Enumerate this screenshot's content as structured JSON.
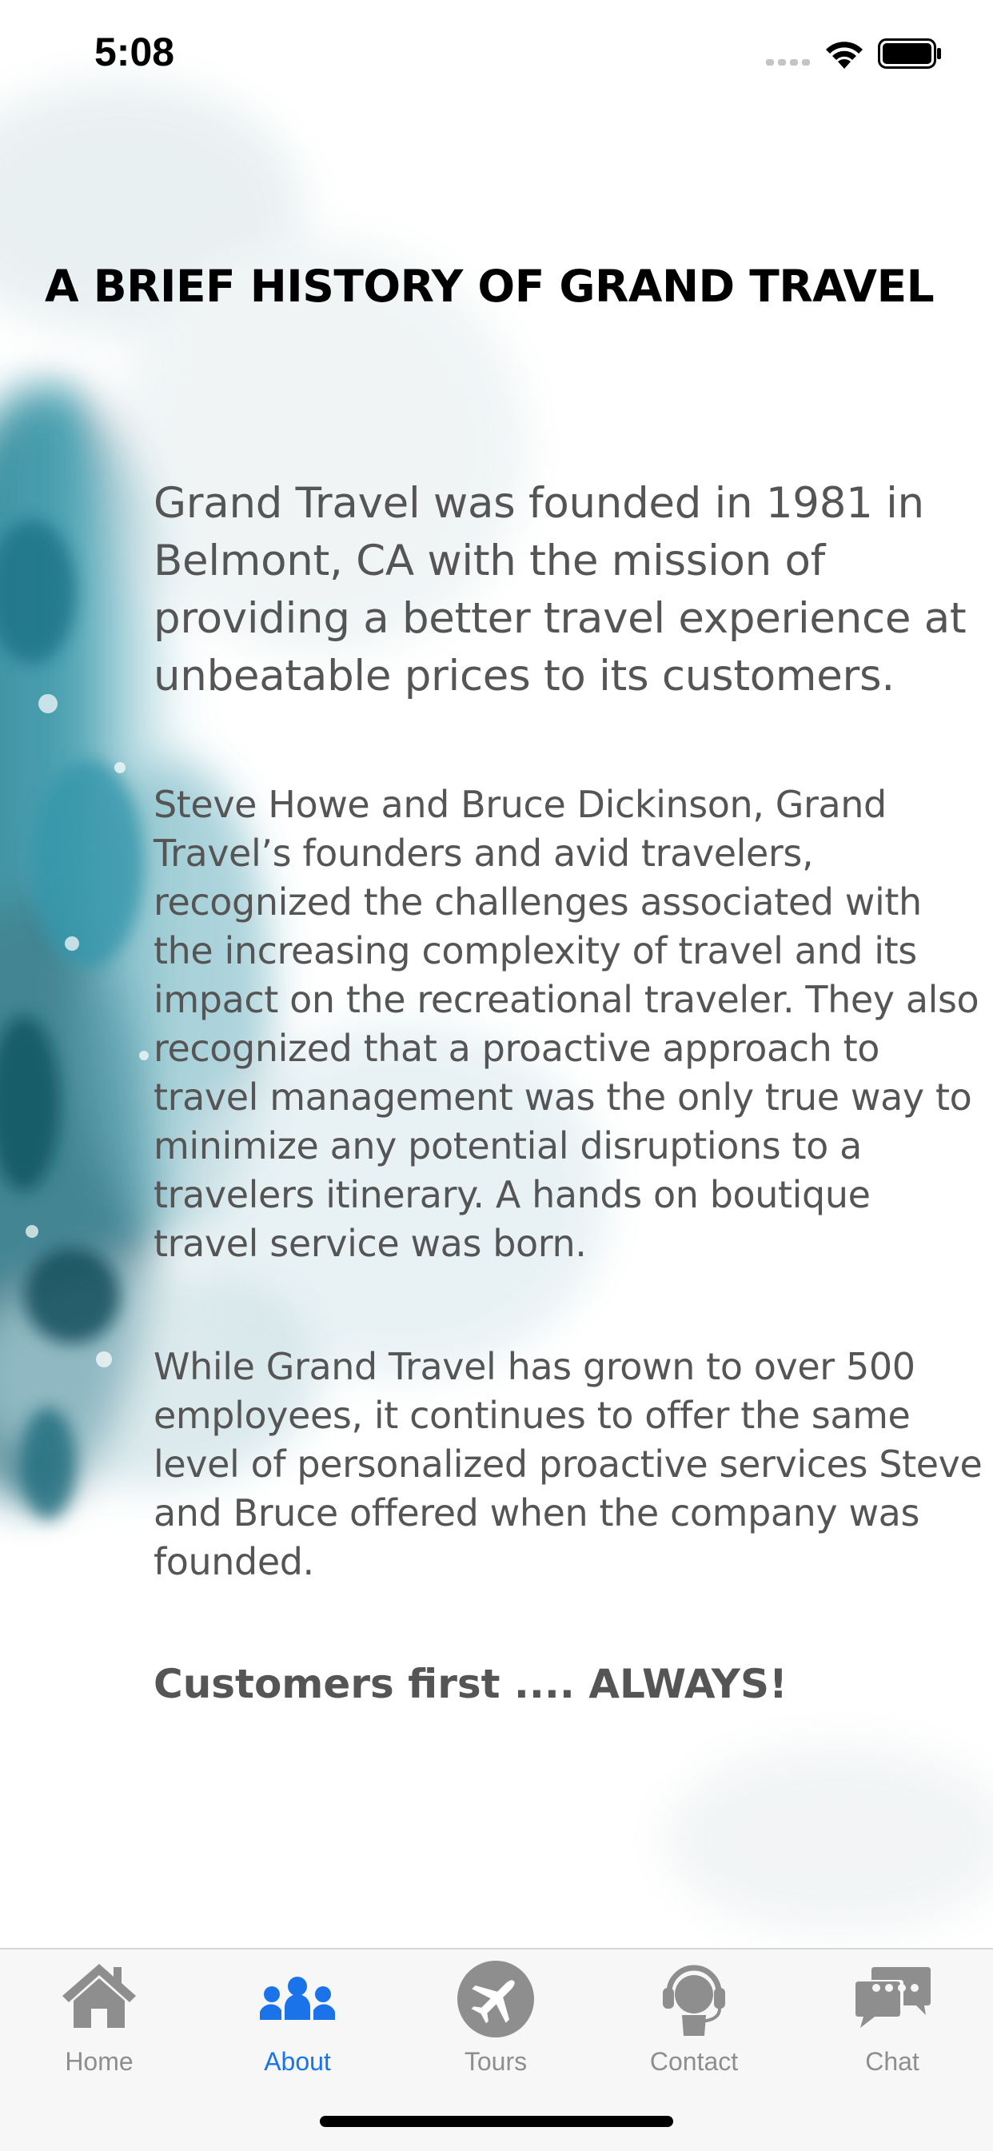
{
  "status_bar": {
    "time": "5:08"
  },
  "page": {
    "title": "A BRIEF HISTORY OF GRAND TRAVEL",
    "intro": "Grand Travel was founded in 1981 in Belmont, CA with the mission of providing a better travel experience at unbeatable prices to its customers.",
    "paragraphs": [
      "Steve Howe and Bruce Dickinson, Grand Travel’s founders and avid travelers, recognized the challenges associated with the increasing complexity of travel and its impact on the recreational traveler. They also recognized that a proactive approach to travel management was the only true way to minimize any potential disruptions to a travelers itinerary. A hands on boutique travel service was born.",
      "While Grand Travel has grown to over 500 employees, it continues to offer the same level of personalized proactive services Steve and Bruce offered when the company was founded."
    ],
    "tagline": "Customers first .... ALWAYS!"
  },
  "tab_bar": {
    "tabs": [
      {
        "label": "Home",
        "icon": "home-icon",
        "active": false
      },
      {
        "label": "About",
        "icon": "people-icon",
        "active": true
      },
      {
        "label": "Tours",
        "icon": "airplane-icon",
        "active": false
      },
      {
        "label": "Contact",
        "icon": "headset-icon",
        "active": false
      },
      {
        "label": "Chat",
        "icon": "chat-bubbles-icon",
        "active": false
      }
    ]
  },
  "colors": {
    "accent": "#1a73e8",
    "inactive": "#8e8e8e",
    "body_text": "#555555",
    "watercolor": "#1f7f93"
  }
}
